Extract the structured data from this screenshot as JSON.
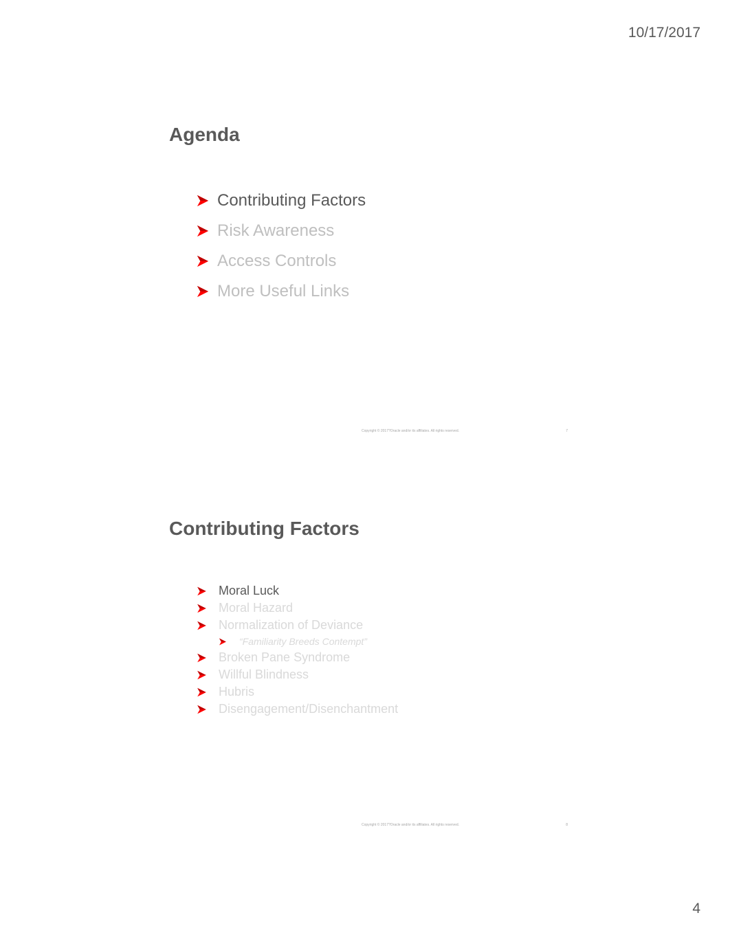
{
  "header": {
    "date": "10/17/2017"
  },
  "page_number": "4",
  "slides": [
    {
      "title": "Agenda",
      "items": [
        {
          "label": "Contributing Factors",
          "state": "active"
        },
        {
          "label": "Risk Awareness",
          "state": "inactive"
        },
        {
          "label": "Access Controls",
          "state": "inactive"
        },
        {
          "label": "More Useful Links",
          "state": "inactive"
        }
      ],
      "footer": {
        "copyright": "Copyright © 2017?Oracle and/or its affiliates. All rights reserved.",
        "slide_number": "7"
      }
    },
    {
      "title": "Contributing Factors",
      "items": [
        {
          "label": "Moral Luck",
          "state": "active"
        },
        {
          "label": "Moral Hazard",
          "state": "inactive"
        },
        {
          "label": "Normalization of Deviance",
          "state": "inactive"
        },
        {
          "label": "“Familiarity Breeds Contempt”",
          "state": "inactive",
          "level": 2
        },
        {
          "label": "Broken Pane Syndrome",
          "state": "inactive"
        },
        {
          "label": "Willful Blindness",
          "state": "inactive"
        },
        {
          "label": "Hubris",
          "state": "inactive"
        },
        {
          "label": "Disengagement/Disenchantment",
          "state": "inactive"
        }
      ],
      "footer": {
        "copyright": "Copyright © 2017?Oracle and/or its affiliates. All rights reserved.",
        "slide_number": "8"
      }
    }
  ],
  "colors": {
    "bullet": "#ff0000",
    "active_text": "#595959",
    "inactive_text": "#bfbfbf"
  }
}
